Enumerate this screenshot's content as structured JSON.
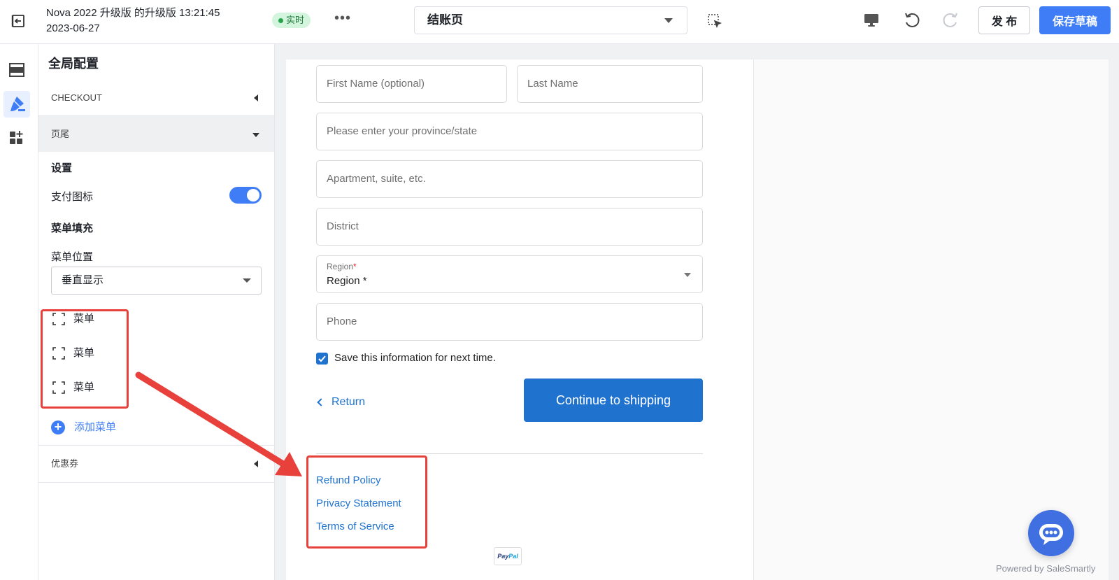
{
  "topbar": {
    "title_line1": "Nova 2022 升级版 的升级版 13:21:45",
    "title_line2": "2023-06-27",
    "live_label": "实时",
    "page_select_value": "结账页",
    "publish_label": "发 布",
    "save_label": "保存草稿"
  },
  "panel": {
    "title": "全局配置",
    "checkout_section": "CHECKOUT",
    "footer_section": "页尾",
    "settings_label": "设置",
    "payment_icon_label": "支付图标",
    "payment_icon_enabled": true,
    "menu_fill_label": "菜单填充",
    "menu_position_label": "菜单位置",
    "menu_position_value": "垂直显示",
    "menu_items": [
      {
        "label": "菜单"
      },
      {
        "label": "菜单"
      },
      {
        "label": "菜单"
      }
    ],
    "add_menu_label": "添加菜单",
    "coupon_section": "优惠券"
  },
  "checkout": {
    "first_name_placeholder": "First Name (optional)",
    "last_name_placeholder": "Last Name",
    "province_placeholder": "Please enter your province/state",
    "apartment_placeholder": "Apartment, suite, etc.",
    "district_placeholder": "District",
    "region_small_label": "Region",
    "region_required_mark": "*",
    "region_value": "Region *",
    "phone_placeholder": "Phone",
    "save_info_label": "Save this information for next time.",
    "save_info_checked": true,
    "return_label": "Return",
    "continue_label": "Continue to shipping",
    "footer_links": [
      "Refund Policy",
      "Privacy Statement",
      "Terms of Service"
    ],
    "payment_logo": "PayPal"
  },
  "widget": {
    "powered_by": "Powered by SaleSmartly"
  },
  "colors": {
    "accent": "#3f7df6",
    "link": "#1f73cf",
    "annotation": "#e8413c",
    "live_badge_bg": "#d3f5dd"
  }
}
